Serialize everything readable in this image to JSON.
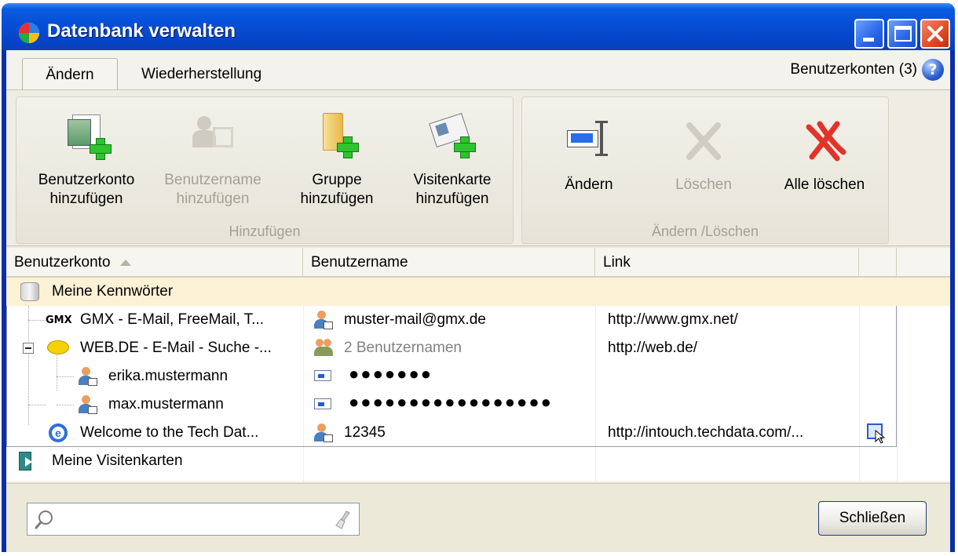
{
  "window": {
    "title": "Datenbank verwalten"
  },
  "tabs": [
    {
      "label": "Ändern",
      "active": true
    },
    {
      "label": "Wiederherstellung",
      "active": false
    }
  ],
  "header": {
    "accounts_label": "Benutzerkonten (3)"
  },
  "ribbon": {
    "groups": [
      {
        "label": "Hinzufügen",
        "buttons": [
          {
            "line1": "Benutzerkonto",
            "line2": "hinzufügen",
            "enabled": true
          },
          {
            "line1": "Benutzername",
            "line2": "hinzufügen",
            "enabled": false
          },
          {
            "line1": "Gruppe",
            "line2": "hinzufügen",
            "enabled": true
          },
          {
            "line1": "Visitenkarte",
            "line2": "hinzufügen",
            "enabled": true
          }
        ]
      },
      {
        "label": "Ändern /Löschen",
        "buttons": [
          {
            "line1": "Ändern",
            "enabled": true
          },
          {
            "line1": "Löschen",
            "enabled": false
          },
          {
            "line1": "Alle löschen",
            "enabled": true
          }
        ]
      }
    ]
  },
  "columns": [
    "Benutzerkonto",
    "Benutzername",
    "Link"
  ],
  "tree": {
    "passwords_group": "Meine Kennwörter",
    "gmx": {
      "name": "GMX - E-Mail, FreeMail, T...",
      "logo": "GMX",
      "username": "muster-mail@gmx.de",
      "link": "http://www.gmx.net/"
    },
    "webde": {
      "name": "WEB.DE - E-Mail - Suche -...",
      "username": "2 Benutzernamen",
      "link": "http://web.de/"
    },
    "webde_children": [
      {
        "name": "erika.mustermann",
        "password": "●●●●●●●"
      },
      {
        "name": "max.mustermann",
        "password": "●●●●●●●●●●●●●●●●●"
      }
    ],
    "techdata": {
      "name": "Welcome to the Tech Dat...",
      "username": "12345",
      "link": "http://intouch.techdata.com/..."
    },
    "cards_group": "Meine Visitenkarten"
  },
  "footer": {
    "close_label": "Schließen",
    "search_value": ""
  },
  "colors": {
    "title_blue": "#0650d8",
    "group_row": "#fdf1d6",
    "plus_green": "#2ec42e"
  }
}
